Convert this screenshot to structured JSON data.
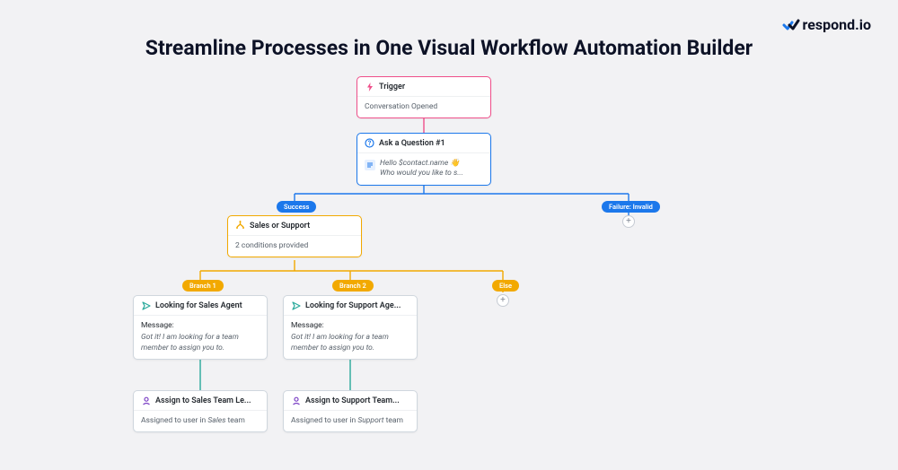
{
  "brand": {
    "name": "respond.io"
  },
  "headline": "Streamline Processes in One Visual Workflow Automation Builder",
  "nodes": {
    "trigger": {
      "title": "Trigger",
      "body": "Conversation Opened"
    },
    "question": {
      "title": "Ask a Question #1",
      "line1": "Hello $contact.name 👋",
      "line2": "Who would you like to s..."
    },
    "branch": {
      "title": "Sales or Support",
      "body": "2 conditions provided"
    },
    "msg1": {
      "title": "Looking for Sales Agent",
      "label": "Message:",
      "text": "Got it! I am looking for a team member to assign you to."
    },
    "msg2": {
      "title": "Looking for Support Age...",
      "label": "Message:",
      "text": "Got it! I am looking for a team member to assign you to."
    },
    "assign1": {
      "title": "Assign to Sales Team Le...",
      "text_a": "Assigned to user in ",
      "text_em": "Sales",
      "text_b": " team"
    },
    "assign2": {
      "title": "Assign to Support Team...",
      "text_a": "Assigned to user in ",
      "text_em": "Support",
      "text_b": " team"
    }
  },
  "pills": {
    "success": "Success",
    "failure": "Failure: Invalid",
    "branch1": "Branch 1",
    "branch2": "Branch 2",
    "else": "Else"
  },
  "colors": {
    "pink": "#ef4f8a",
    "blue": "#1c78eb",
    "yellow": "#f2a900",
    "teal": "#27a89a"
  }
}
